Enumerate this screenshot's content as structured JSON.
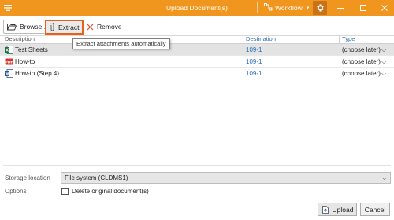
{
  "window": {
    "title": "Upload Document(s)",
    "workflow_label": "Workflow",
    "accent": "#f0961e"
  },
  "toolbar": {
    "browse_label": "Browse...",
    "extract_label": "Extract",
    "remove_label": "Remove",
    "tooltip": "Extract attachments automatically"
  },
  "table": {
    "columns": [
      "Description",
      "Destination",
      "Type"
    ],
    "rows": [
      {
        "name": "Test Sheets",
        "icon": "excel-icon",
        "destination": "109-1",
        "type": "(choose later)"
      },
      {
        "name": "How-to",
        "icon": "pdf-icon",
        "destination": "109-1",
        "type": "(choose later)"
      },
      {
        "name": "How-to (Step 4)",
        "icon": "word-icon",
        "destination": "109-1",
        "type": "(choose later)"
      }
    ]
  },
  "storage": {
    "label": "Storage location",
    "value": "File system (CLDMS1)"
  },
  "options": {
    "label": "Options",
    "checkbox_label": "Delete original document(s)",
    "checked": false
  },
  "footer": {
    "upload_label": "Upload",
    "cancel_label": "Cancel"
  }
}
